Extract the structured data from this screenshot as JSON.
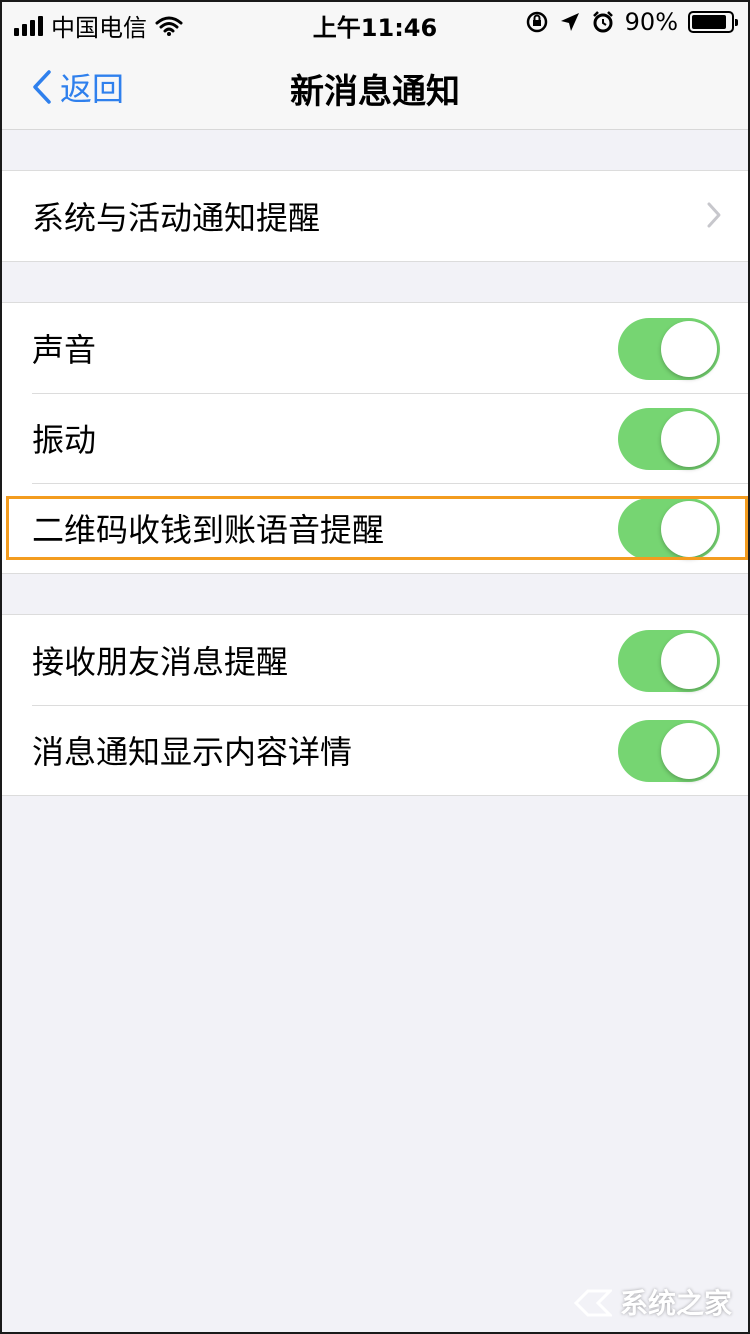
{
  "status_bar": {
    "carrier": "中国电信",
    "time": "上午11:46",
    "battery_percent": "90%",
    "battery_level": 0.9,
    "icons": [
      "signal-icon",
      "wifi-icon",
      "rotation-lock-icon",
      "location-icon",
      "alarm-icon",
      "battery-icon"
    ]
  },
  "nav": {
    "back_label": "返回",
    "title": "新消息通知"
  },
  "group1": {
    "items": [
      {
        "label": "系统与活动通知提醒",
        "control": "chevron"
      }
    ]
  },
  "group2": {
    "items": [
      {
        "label": "声音",
        "on": true
      },
      {
        "label": "振动",
        "on": true
      },
      {
        "label": "二维码收钱到账语音提醒",
        "on": true,
        "highlighted": true
      }
    ]
  },
  "group3": {
    "items": [
      {
        "label": "接收朋友消息提醒",
        "on": true
      },
      {
        "label": "消息通知显示内容详情",
        "on": true
      }
    ]
  },
  "colors": {
    "toggle_on": "#76d572",
    "accent": "#2f80ed",
    "highlight": "#f39c1f",
    "background": "#f2f2f7"
  },
  "watermark": {
    "text": "系统之家"
  }
}
